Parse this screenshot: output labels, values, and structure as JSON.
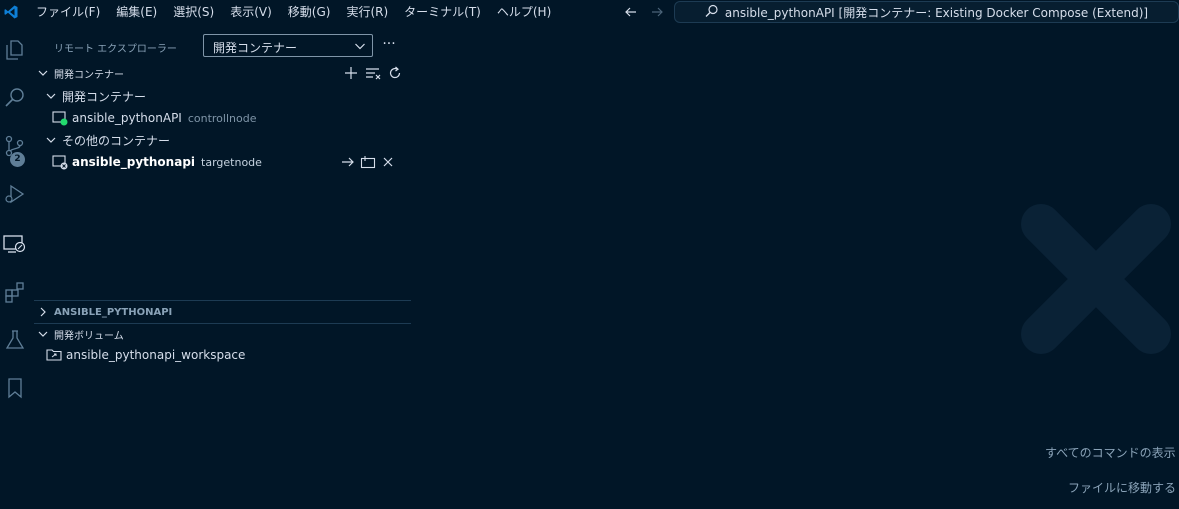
{
  "titlebar": {
    "menu": [
      {
        "label": "ファイル(F)"
      },
      {
        "label": "編集(E)"
      },
      {
        "label": "選択(S)"
      },
      {
        "label": "表示(V)"
      },
      {
        "label": "移動(G)"
      },
      {
        "label": "実行(R)"
      },
      {
        "label": "ターミナル(T)"
      },
      {
        "label": "ヘルプ(H)"
      }
    ],
    "command_center": "ansible_pythonAPI [開発コンテナー: Existing Docker Compose (Extend)]"
  },
  "activitybar": {
    "items": [
      "explorer-icon",
      "search-icon",
      "source-control-icon",
      "run-debug-icon",
      "remote-explorer-icon",
      "extensions-icon",
      "testing-icon",
      "bookmark-icon"
    ],
    "scm_badge": "2"
  },
  "sidebar": {
    "title": "リモート エクスプローラー",
    "select_value": "開発コンテナー",
    "more": "···",
    "sections": {
      "dev_containers": "開発コンテナー",
      "workspace": "ANSIBLE_PYTHONAPI",
      "volumes": "開発ボリューム"
    },
    "groups": {
      "dev": "開発コンテナー",
      "other": "その他のコンテナー"
    },
    "containers": [
      {
        "name": "ansible_pythonAPI",
        "desc": "controllnode",
        "status": "running"
      },
      {
        "name": "ansible_pythonapi",
        "desc": "targetnode",
        "status": "stopped"
      }
    ],
    "volume_item": "ansible_pythonapi_workspace"
  },
  "editor": {
    "hints": {
      "show_all_commands": "すべてのコマンドの表示",
      "go_to_file": "ファイルに移動する"
    }
  },
  "colors": {
    "background": "#011627",
    "accent": "#0e7fd6",
    "running": "#22da6e"
  }
}
